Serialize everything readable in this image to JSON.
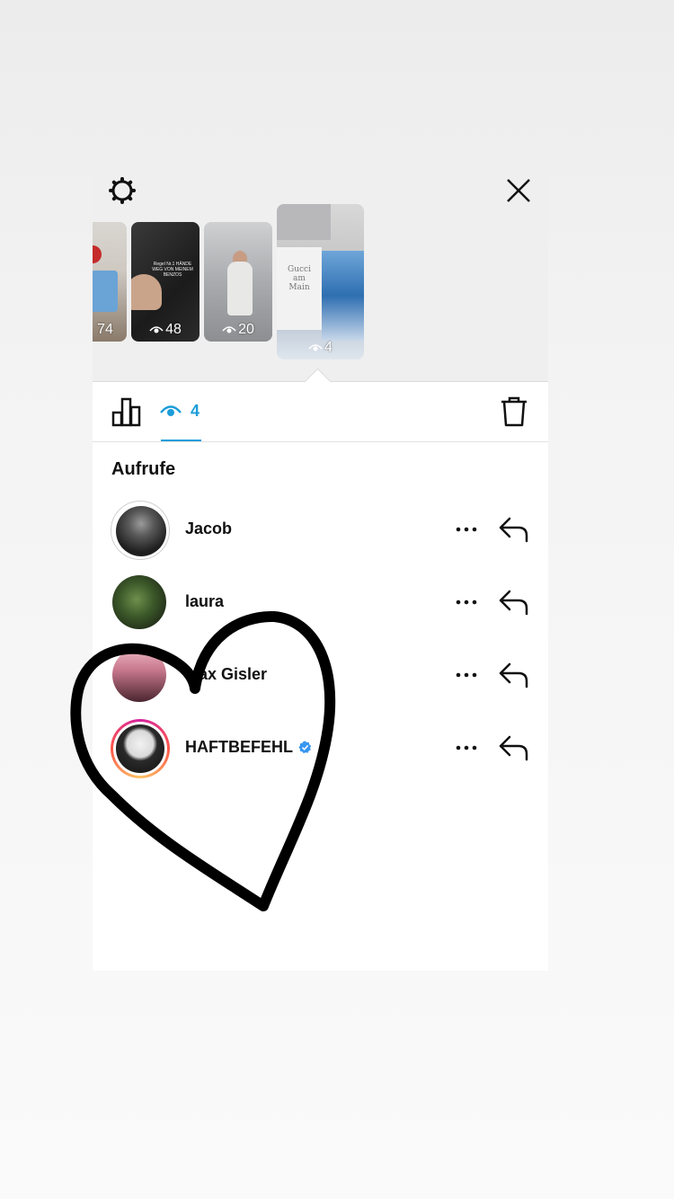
{
  "thumbnails": [
    {
      "views": "74"
    },
    {
      "views": "48",
      "text": "Regel Nr.1 HÄNDE WEG VON MEINEM BENZOS"
    },
    {
      "views": "20"
    },
    {
      "views": "4",
      "text": "Gucci am Main"
    }
  ],
  "tabs": {
    "insights_icon": "bar-chart-icon",
    "viewers_count": "4",
    "delete_icon": "trash-icon"
  },
  "section": {
    "title": "Aufrufe"
  },
  "viewers": [
    {
      "name": "Jacob",
      "verified": false
    },
    {
      "name": "laura",
      "verified": false
    },
    {
      "name": "Max Gisler",
      "verified": false
    },
    {
      "name": "HAFTBEFEHL",
      "verified": true
    }
  ],
  "colors": {
    "accent": "#1a9dd9",
    "verified": "#3897f0"
  }
}
